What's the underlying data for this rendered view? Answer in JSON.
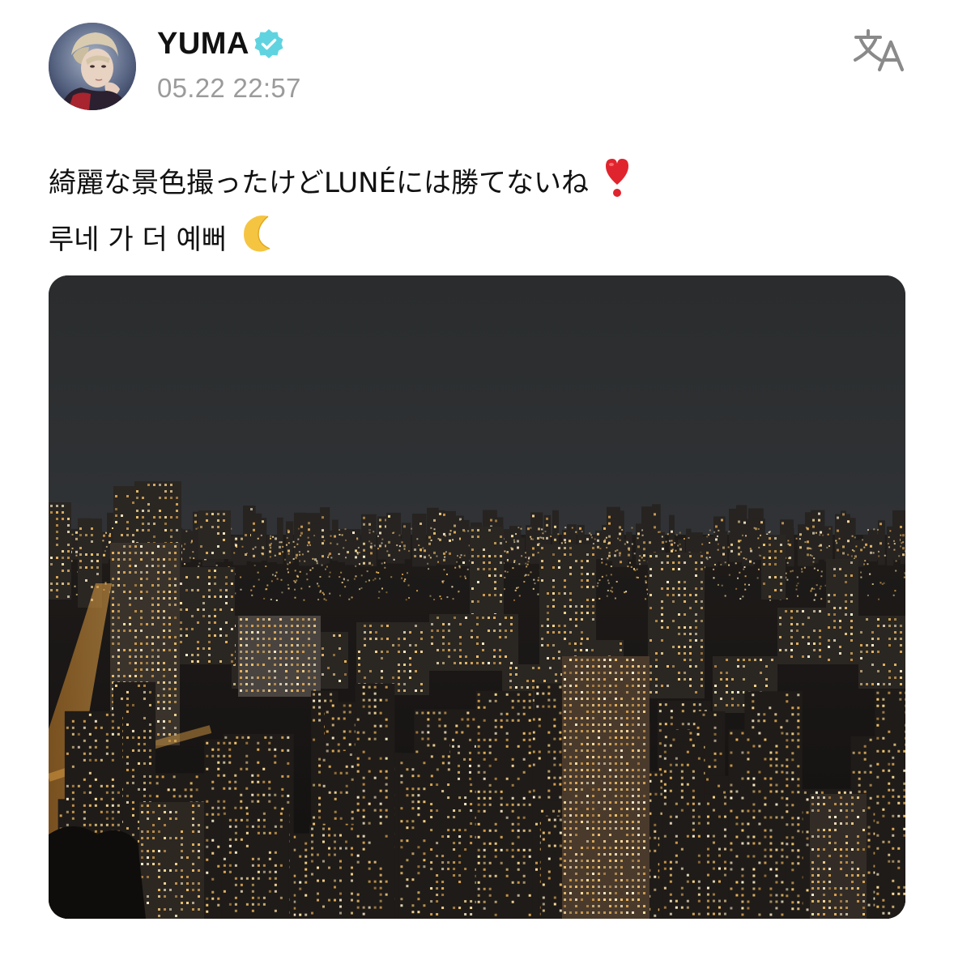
{
  "post": {
    "author": {
      "name": "YUMA",
      "verified": true,
      "avatar_icon": "profile-photo"
    },
    "timestamp": "05.22 22:57",
    "translate_icon": "translate-icon",
    "text_lines": [
      "綺麗な景色撮ったけどLUNÉには勝てないね",
      "루네 가 더 예뻐"
    ],
    "line1_emoji": "heart-exclamation-icon",
    "line2_emoji": "crescent-moon-icon",
    "photo": {
      "subject": "night-city-skyline-photo"
    }
  },
  "colors": {
    "verified_badge": "#5fd4e0",
    "timestamp": "#9b9b9b",
    "text": "#111111",
    "heart": "#e0242e",
    "moon": "#f5c542",
    "translate_icon": "#8a8a8a"
  }
}
